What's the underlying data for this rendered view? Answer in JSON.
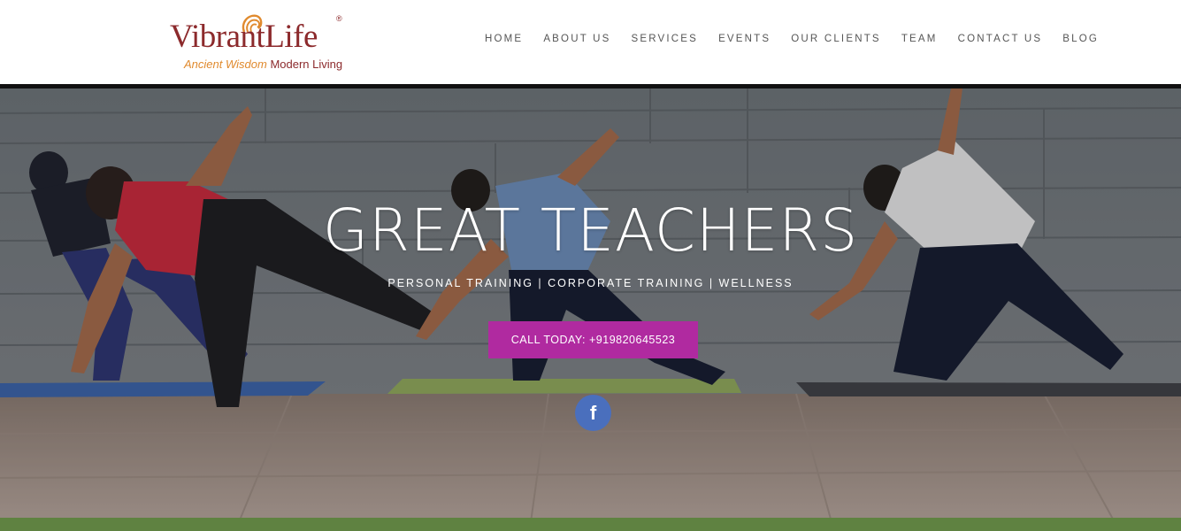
{
  "brand": {
    "name": "VibrantLife",
    "registered": "®",
    "tagline_part1": "Ancient Wisdom",
    "tagline_part2": "Modern Living",
    "colors": {
      "primary": "#8c2a2c",
      "accent": "#e08a2e"
    }
  },
  "nav": {
    "items": [
      {
        "label": "HOME"
      },
      {
        "label": "ABOUT US"
      },
      {
        "label": "SERVICES"
      },
      {
        "label": "EVENTS"
      },
      {
        "label": "OUR CLIENTS"
      },
      {
        "label": "TEAM"
      },
      {
        "label": "CONTACT US"
      },
      {
        "label": "BLOG"
      }
    ]
  },
  "hero": {
    "title": "GREAT TEACHERS",
    "subtitle": "PERSONAL TRAINING | CORPORATE TRAINING | WELLNESS",
    "cta_label": "CALL TODAY: +919820645523",
    "cta_color": "#b02aa0",
    "social_icon": "facebook-icon",
    "social_glyph": "f",
    "social_color": "#4a6fbd"
  }
}
